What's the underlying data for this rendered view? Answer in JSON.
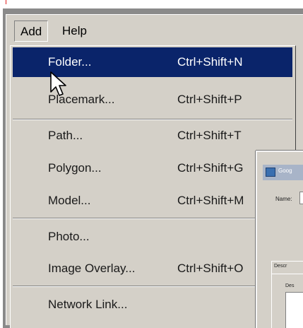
{
  "menubar": {
    "items": [
      {
        "label": "Add"
      },
      {
        "label": "Help"
      }
    ]
  },
  "add_menu": {
    "items": [
      {
        "label": "Folder...",
        "shortcut": "Ctrl+Shift+N"
      },
      {
        "label": "Placemark...",
        "shortcut": "Ctrl+Shift+P"
      },
      {
        "label": "Path...",
        "shortcut": "Ctrl+Shift+T"
      },
      {
        "label": "Polygon...",
        "shortcut": "Ctrl+Shift+G"
      },
      {
        "label": "Model...",
        "shortcut": "Ctrl+Shift+M"
      },
      {
        "label": "Photo...",
        "shortcut": ""
      },
      {
        "label": "Image Overlay...",
        "shortcut": "Ctrl+Shift+O"
      },
      {
        "label": "Network Link...",
        "shortcut": ""
      }
    ],
    "highlighted_item": "Folder..."
  },
  "background_dialog": {
    "title": "Goog",
    "name_label": "Name:",
    "tab_label": "Descr",
    "description_label": "Des"
  },
  "colors": {
    "highlight": "#0a246a",
    "menu_bg": "#d4d0c8",
    "accent_mark": "#e02020"
  },
  "icons": {
    "cursor": "arrow-cursor-icon",
    "dialog_app": "app-icon"
  }
}
